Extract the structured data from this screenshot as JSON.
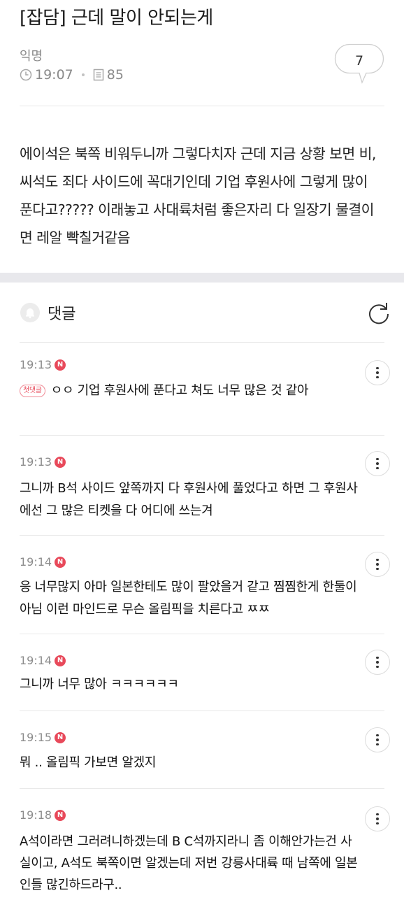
{
  "post": {
    "title": "[잡담] 근데 말이 안되는게",
    "author": "익명",
    "time": "19:07",
    "views": "85",
    "comment_count": "7",
    "body": "에이석은 북쪽 비워두니까 그렇다치자 근데 지금 상황 보면 비,씨석도 죄다 사이드에 꼭대기인데 기업 후원사에 그렇게 많이 푼다고????? 이래놓고 사대륙처럼 좋은자리 다 일장기 물결이면 레알 빡칠거같음"
  },
  "comments_section": {
    "label": "댓글"
  },
  "comments": [
    {
      "time": "19:13",
      "badge": "N",
      "first_label": "첫댓글",
      "text": "ㅇㅇ 기업 후원사에 푼다고 쳐도 너무 많은 것 같아"
    },
    {
      "time": "19:13",
      "badge": "N",
      "text": "그니까 B석 사이드 앞쪽까지 다 후원사에 풀었다고 하면 그 후원사에선 그 많은 티켓을 다 어디에 쓰는겨"
    },
    {
      "time": "19:14",
      "badge": "N",
      "text": "응 너무많지 아마 일본한테도 많이 팔았을거 같고 찜찜한게 한둘이 아님 이런 마인드로 무슨 올림픽을 치른다고 ㅉㅉ"
    },
    {
      "time": "19:14",
      "badge": "N",
      "text": "그니까 너무 많아 ㅋㅋㅋㅋㅋㅋ"
    },
    {
      "time": "19:15",
      "badge": "N",
      "text": "뭐 .. 올림픽 가보면 알겠지"
    },
    {
      "time": "19:18",
      "badge": "N",
      "text": "A석이라면 그러려니하겠는데 B C석까지라니 좀 이해안가는건 사실이고, A석도 북쪽이면 알겠는데 저번 강릉사대륙 때 남쪽에 일본인들 많긴하드라구.."
    }
  ]
}
